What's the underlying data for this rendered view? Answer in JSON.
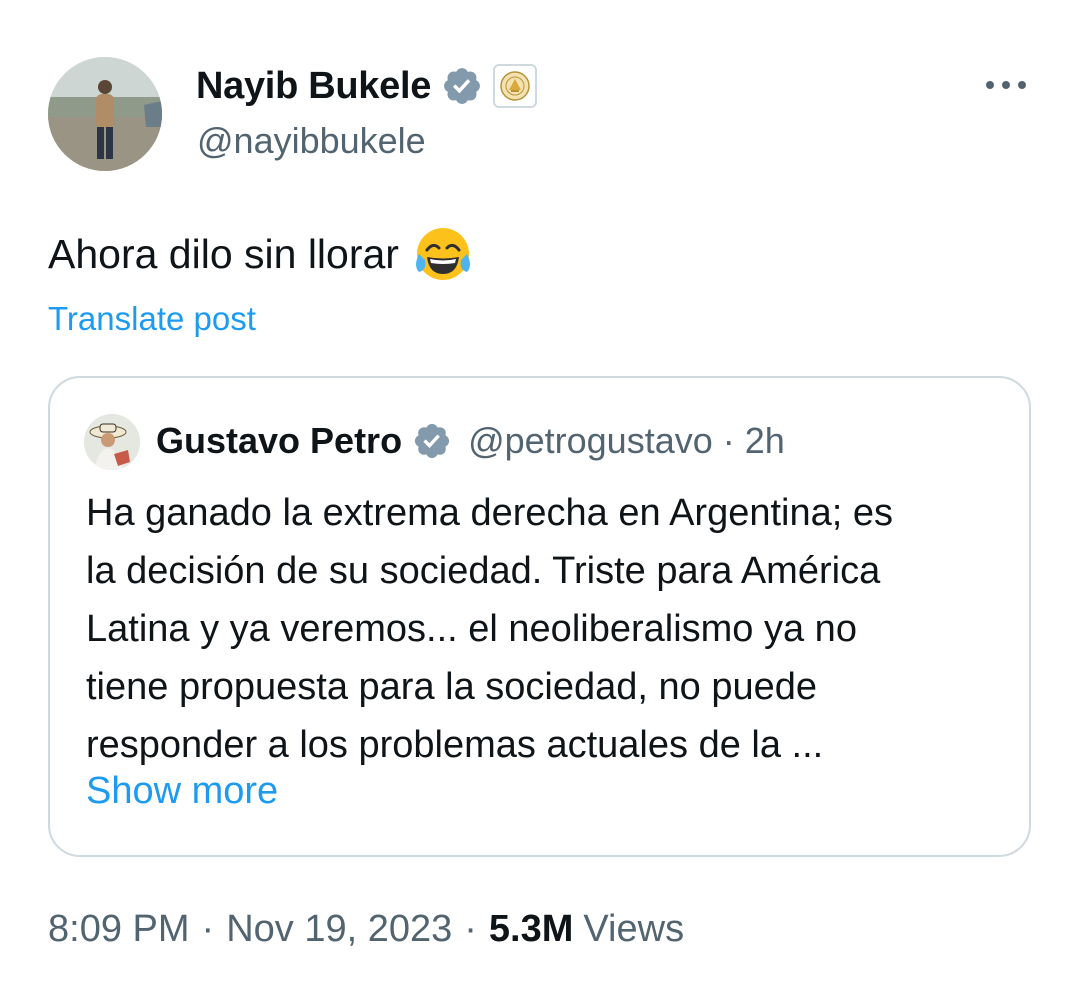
{
  "author": {
    "display_name": "Nayib Bukele",
    "handle": "@nayibbukele",
    "verified_icon": "verified-badge-icon",
    "affiliation_icon": "government-seal-icon"
  },
  "post": {
    "text": "Ahora dilo sin llorar",
    "emoji": "face-with-tears-of-joy-emoji",
    "translate_label": "Translate post"
  },
  "quoted_post": {
    "display_name": "Gustavo Petro",
    "handle": "@petrogustavo",
    "separator": "·",
    "time": "2h",
    "text_lines": [
      "Ha ganado la extrema derecha en Argentina; es",
      "la decisión de su sociedad. Triste para América",
      "Latina y ya veremos... el neoliberalismo ya no",
      "tiene propuesta para la sociedad, no puede",
      "responder a los problemas actuales de la ..."
    ],
    "show_more_label": "Show more"
  },
  "meta": {
    "time": "8:09 PM",
    "separator": "·",
    "date": "Nov 19, 2023",
    "views_count": "5.3M",
    "views_label": "Views"
  },
  "colors": {
    "text_primary": "#0f1419",
    "text_secondary": "#536471",
    "link": "#1d9bf0",
    "border": "#cfd9de",
    "badge": "#829aab"
  }
}
